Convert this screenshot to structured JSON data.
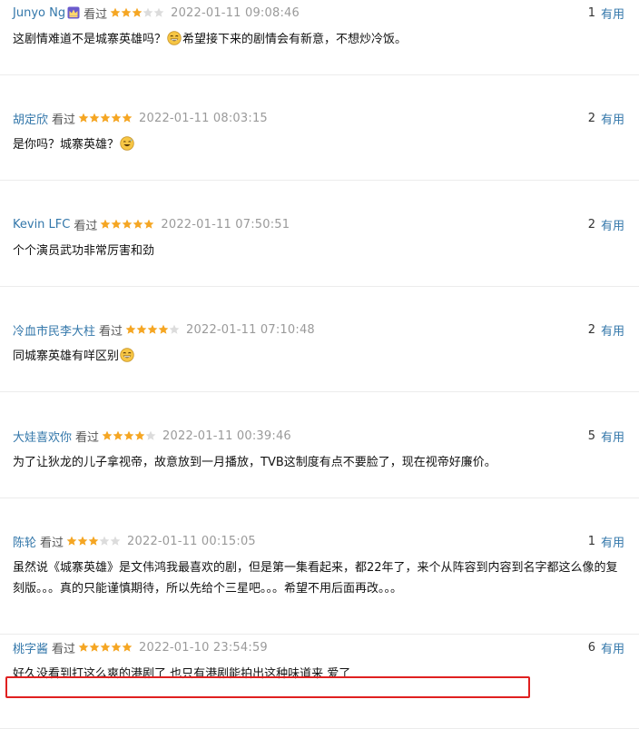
{
  "accent_color": "#3377aa",
  "star_color": "#f5a623",
  "highlight_color": "#e02020",
  "comments": [
    {
      "user": "Junyo Ng",
      "badge": "crown-badge-icon",
      "status": "看过",
      "rating": 3,
      "time": "2022-01-11 09:08:46",
      "votes": "1",
      "useful_label": "有用",
      "text_a": "这剧情难道不是城寨英雄吗？",
      "emoji_a": "grinning-emoji-icon",
      "text_b": "希望接下来的剧情会有新意，不想炒冷饭。"
    },
    {
      "user": "胡定欣",
      "status": "看过",
      "rating": 5,
      "time": "2022-01-11 08:03:15",
      "votes": "2",
      "useful_label": "有用",
      "text_a": "是你吗？城寨英雄？",
      "emoji_a": "sweat-smile-emoji-icon"
    },
    {
      "user": "Kevin LFC",
      "status": "看过",
      "rating": 5,
      "time": "2022-01-11 07:50:51",
      "votes": "2",
      "useful_label": "有用",
      "text_a": "个个演员武功非常厉害和劲"
    },
    {
      "user": "冷血市民李大柱",
      "status": "看过",
      "rating": 4,
      "time": "2022-01-11 07:10:48",
      "votes": "2",
      "useful_label": "有用",
      "text_a": "同城寨英雄有咩区别",
      "emoji_a": "grinning-emoji-icon"
    },
    {
      "user": "大娃喜欢你",
      "status": "看过",
      "rating": 4,
      "time": "2022-01-11 00:39:46",
      "votes": "5",
      "useful_label": "有用",
      "text_a": "为了让狄龙的儿子拿视帝，故意放到一月播放，TVB这制度有点不要脸了，现在视帝好廉价。"
    },
    {
      "user": "陈轮",
      "status": "看过",
      "rating": 3,
      "time": "2022-01-11 00:15:05",
      "votes": "1",
      "useful_label": "有用",
      "text_a": "虽然说《城寨英雄》是文伟鸿我最喜欢的剧，但是第一集看起来，都22年了，来个从阵容到内容到名字都这么像的复刻版。。。真的只能谨慎期待，所以先给个三星吧。。。希望不用后面再改。。。"
    },
    {
      "user": "桃字酱",
      "status": "看过",
      "rating": 5,
      "time": "2022-01-10 23:54:59",
      "votes": "6",
      "useful_label": "有用",
      "text_a": "好久没看到打这么爽的港剧了 也只有港剧能拍出这种味道来 爱了"
    }
  ]
}
